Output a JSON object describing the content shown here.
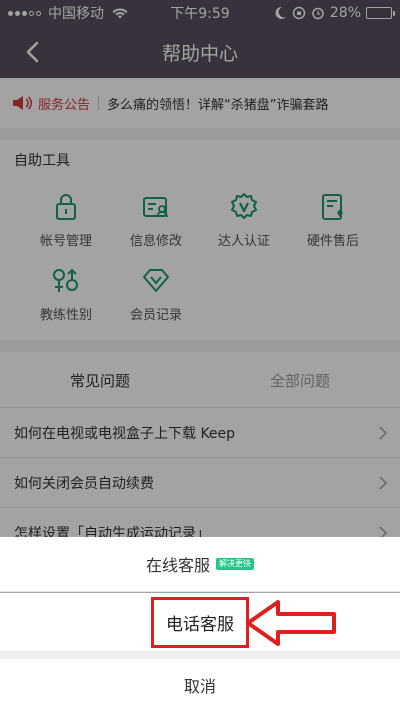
{
  "status_bar": {
    "carrier": "中国移动",
    "time": "下午9:59",
    "battery_pct": "28%",
    "battery_level": 0.28
  },
  "navbar": {
    "title": "帮助中心"
  },
  "notice": {
    "tag": "服务公告",
    "text": "多么痛的领悟！详解“杀猪盘”诈骗套路"
  },
  "tools": {
    "title": "自助工具",
    "items": [
      {
        "label": "帐号管理",
        "icon": "lock-icon"
      },
      {
        "label": "信息修改",
        "icon": "profile-card-icon"
      },
      {
        "label": "达人认证",
        "icon": "verified-badge-icon"
      },
      {
        "label": "硬件售后",
        "icon": "hardware-document-icon"
      },
      {
        "label": "教练性别",
        "icon": "gender-icon"
      },
      {
        "label": "会员记录",
        "icon": "diamond-icon"
      }
    ]
  },
  "faq": {
    "tabs": [
      "常见问题",
      "全部问题"
    ],
    "rows": [
      "如何在电视或电视盒子上下载 Keep",
      "如何关闭会员自动续费",
      "怎样设置「自动生成运动记录」"
    ]
  },
  "sheet": {
    "online": "在线客服",
    "online_badge": "解决更快",
    "phone": "电话客服",
    "cancel": "取消"
  },
  "colors": {
    "accent_green": "#1a9a6b",
    "nav_bg": "#584f60",
    "highlight_red": "#e02020"
  }
}
